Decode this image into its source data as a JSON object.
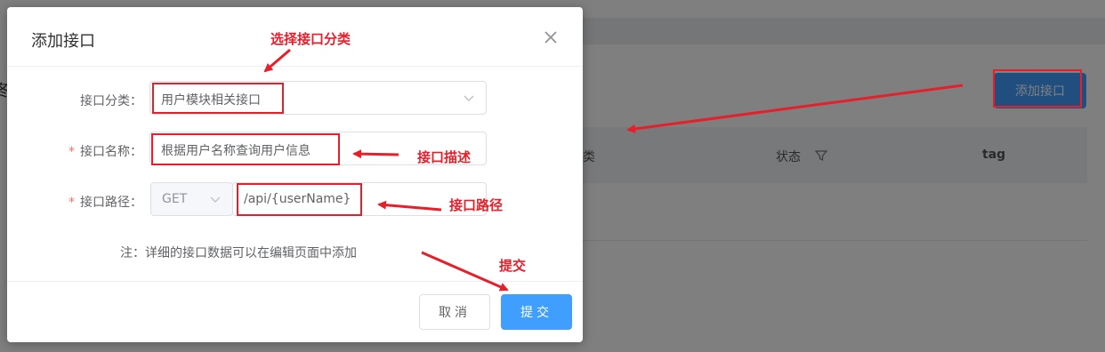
{
  "background": {
    "title_stub": "冬",
    "add_button_label": "添加接口",
    "columns": [
      "类",
      "状态",
      "tag"
    ]
  },
  "dialog": {
    "title": "添加接口",
    "fields": {
      "category": {
        "label": "接口分类：",
        "value": "用户模块相关接口",
        "required": false
      },
      "name": {
        "label": "接口名称：",
        "value": "根据用户名称查询用户信息",
        "required": true
      },
      "path": {
        "label": "接口路径：",
        "method": "GET",
        "value": "/api/{userName}",
        "required": true
      }
    },
    "required_mark": "*",
    "note": "注：详细的接口数据可以在编辑页面中添加",
    "cancel_label": "取消",
    "submit_label": "提交"
  },
  "annotations": {
    "select_category": "选择接口分类",
    "describe": "接口描述",
    "path": "接口路径",
    "submit": "提交"
  },
  "colors": {
    "primary": "#409eff",
    "annotation_red": "#e6202b",
    "required_red": "#f56c6c"
  },
  "icons": [
    "close-icon",
    "chevron-down-icon",
    "filter-icon"
  ]
}
